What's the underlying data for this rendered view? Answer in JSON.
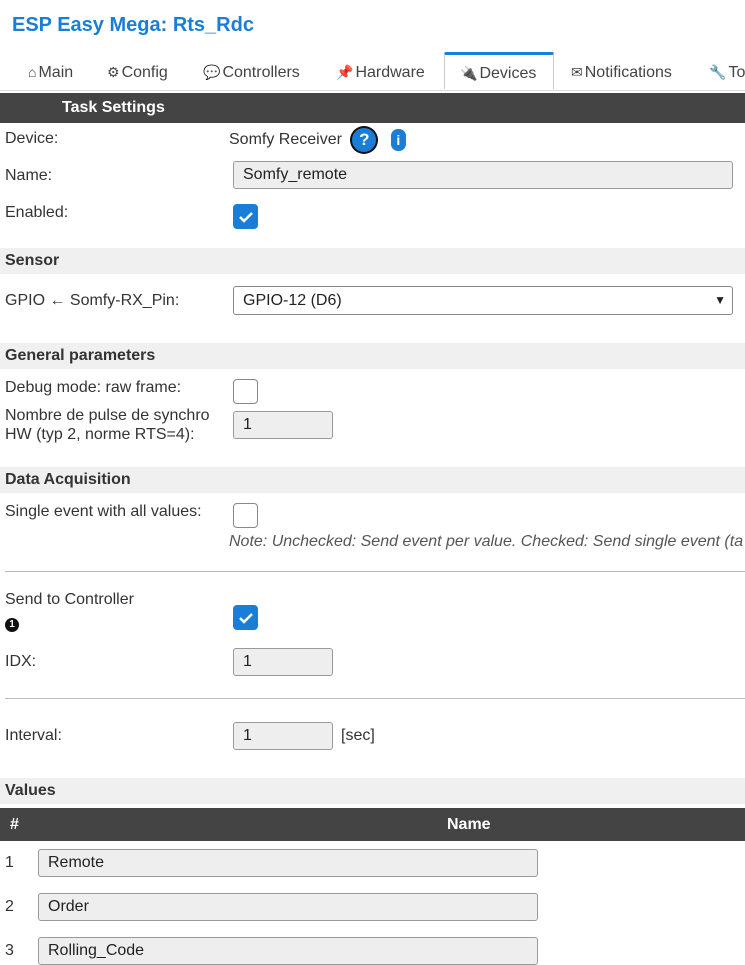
{
  "app": {
    "title": "ESP Easy Mega: Rts_Rdc"
  },
  "tabs": [
    {
      "icon": "⌂",
      "label": "Main"
    },
    {
      "icon": "⚙",
      "label": "Config"
    },
    {
      "icon": "💬",
      "label": "Controllers"
    },
    {
      "icon": "📌",
      "label": "Hardware"
    },
    {
      "icon": "🔌",
      "label": "Devices",
      "active": true
    },
    {
      "icon": "✉",
      "label": "Notifications"
    },
    {
      "icon": "🔧",
      "label": "To"
    }
  ],
  "task_settings": {
    "header": "Task Settings",
    "device_label": "Device:",
    "device_value": "Somfy Receiver",
    "help_q": "?",
    "help_i": "i",
    "name_label": "Name:",
    "name_value": "Somfy_remote",
    "enabled_label": "Enabled:",
    "enabled": true
  },
  "sensor": {
    "header": "Sensor",
    "gpio_label": "GPIO ← Somfy-RX_Pin:",
    "gpio_value": "GPIO-12 (D6)"
  },
  "general": {
    "header": "General parameters",
    "debug_label": "Debug mode: raw frame:",
    "debug": false,
    "pulse_label_1": "Nombre de pulse de synchro",
    "pulse_label_2": "HW (typ 2, norme RTS=4):",
    "pulse_value": "1"
  },
  "acquisition": {
    "header": "Data Acquisition",
    "single_event_label": "Single event with all values:",
    "single_event": false,
    "note": "Note: Unchecked: Send event per value. Checked: Send single event (ta",
    "send_ctrl_label": "Send to Controller",
    "send_ctrl": true,
    "info_mark": "1",
    "idx_label": "IDX:",
    "idx_value": "1",
    "interval_label": "Interval:",
    "interval_value": "1",
    "interval_unit": "[sec]"
  },
  "values": {
    "header": "Values",
    "col_num": "#",
    "col_name": "Name",
    "rows": [
      {
        "num": "1",
        "name": "Remote"
      },
      {
        "num": "2",
        "name": "Order"
      },
      {
        "num": "3",
        "name": "Rolling_Code"
      }
    ]
  }
}
